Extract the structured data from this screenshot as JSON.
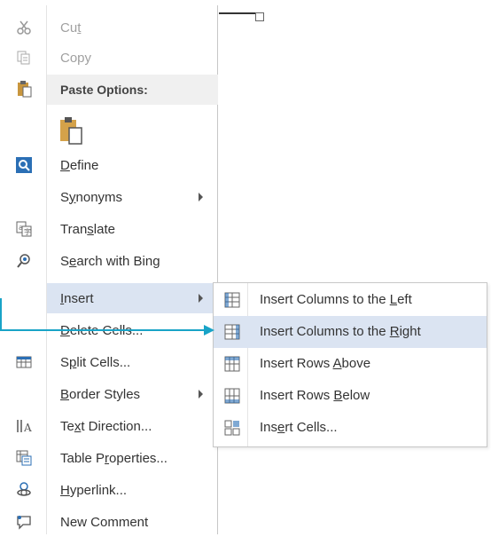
{
  "context_menu": {
    "items": [
      {
        "id": "cut",
        "label_pre": "Cu",
        "label_u": "t",
        "label_post": "",
        "icon": "scissors-icon",
        "disabled": true
      },
      {
        "id": "copy",
        "label_pre": "Copy",
        "label_u": "",
        "label_post": "",
        "icon": "copy-icon",
        "disabled": true
      },
      {
        "id": "paste-options",
        "label_pre": "Paste Options:",
        "label_u": "",
        "label_post": "",
        "icon": "clipboard-icon"
      },
      {
        "id": "define",
        "label_pre": "",
        "label_u": "D",
        "label_post": "efine",
        "icon": "define-icon"
      },
      {
        "id": "synonyms",
        "label_pre": "S",
        "label_u": "y",
        "label_post": "nonyms",
        "icon": ""
      },
      {
        "id": "translate",
        "label_pre": "Tran",
        "label_u": "s",
        "label_post": "late",
        "icon": "translate-icon"
      },
      {
        "id": "search-bing",
        "label_pre": "S",
        "label_u": "e",
        "label_post": "arch with Bing",
        "icon": "search-icon"
      },
      {
        "id": "insert",
        "label_pre": "",
        "label_u": "I",
        "label_post": "nsert",
        "icon": ""
      },
      {
        "id": "delete-cells",
        "label_pre": "",
        "label_u": "D",
        "label_post": "elete Cells...",
        "icon": ""
      },
      {
        "id": "split-cells",
        "label_pre": "S",
        "label_u": "p",
        "label_post": "lit Cells...",
        "icon": "split-cells-icon"
      },
      {
        "id": "border-styles",
        "label_pre": "",
        "label_u": "B",
        "label_post": "order Styles",
        "icon": ""
      },
      {
        "id": "text-direction",
        "label_pre": "Te",
        "label_u": "x",
        "label_post": "t Direction...",
        "icon": "text-direction-icon"
      },
      {
        "id": "table-properties",
        "label_pre": "Table P",
        "label_u": "r",
        "label_post": "operties...",
        "icon": "table-properties-icon"
      },
      {
        "id": "hyperlink",
        "label_pre": "",
        "label_u": "H",
        "label_post": "yperlink...",
        "icon": "hyperlink-icon"
      },
      {
        "id": "new-comment",
        "label_pre": "New Comment",
        "label_u": "",
        "label_post": "",
        "icon": "comment-icon"
      }
    ]
  },
  "submenu": {
    "items": [
      {
        "id": "insert-col-left",
        "label_pre": "Insert Columns to the ",
        "label_u": "L",
        "label_post": "eft",
        "icon": "insert-column-left-icon"
      },
      {
        "id": "insert-col-right",
        "label_pre": "Insert Columns to the ",
        "label_u": "R",
        "label_post": "ight",
        "icon": "insert-column-right-icon"
      },
      {
        "id": "insert-rows-above",
        "label_pre": "Insert Rows ",
        "label_u": "A",
        "label_post": "bove",
        "icon": "insert-row-above-icon"
      },
      {
        "id": "insert-rows-below",
        "label_pre": "Insert Rows ",
        "label_u": "B",
        "label_post": "elow",
        "icon": "insert-row-below-icon"
      },
      {
        "id": "insert-cells",
        "label_pre": "Ins",
        "label_u": "e",
        "label_post": "rt Cells...",
        "icon": "insert-cells-icon"
      }
    ]
  },
  "colors": {
    "highlight": "#dbe4f2",
    "pointer": "#19a3c7",
    "disabled_text": "#a0a0a0"
  }
}
